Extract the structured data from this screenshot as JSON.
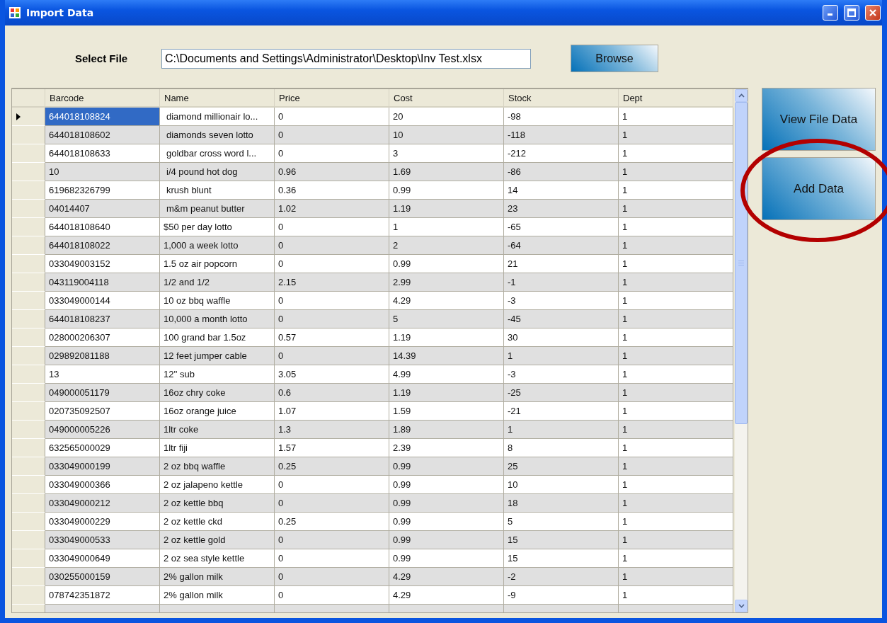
{
  "window": {
    "title": "Import Data"
  },
  "file": {
    "label": "Select File",
    "value": "C:\\Documents and Settings\\Administrator\\Desktop\\Inv Test.xlsx",
    "browse": "Browse"
  },
  "table": {
    "columns": [
      "Barcode",
      "Name",
      "Price",
      "Cost",
      "Stock",
      "Dept"
    ],
    "rows": [
      {
        "selected": true,
        "cells": [
          "644018108824",
          "diamond millionair lo...",
          "0",
          "20",
          "-98",
          "1"
        ]
      },
      {
        "selected": false,
        "cells": [
          "644018108602",
          "diamonds seven lotto",
          "0",
          "10",
          "-118",
          "1"
        ]
      },
      {
        "selected": false,
        "cells": [
          "644018108633",
          "goldbar cross word l...",
          "0",
          "3",
          "-212",
          "1"
        ]
      },
      {
        "selected": false,
        "cells": [
          "10",
          "i/4 pound hot dog",
          "0.96",
          "1.69",
          "-86",
          "1"
        ]
      },
      {
        "selected": false,
        "cells": [
          "619682326799",
          "krush blunt",
          "0.36",
          "0.99",
          "14",
          "1"
        ]
      },
      {
        "selected": false,
        "cells": [
          "04014407",
          "m&m peanut butter",
          "1.02",
          "1.19",
          "23",
          "1"
        ]
      },
      {
        "selected": false,
        "cells": [
          "644018108640",
          "$50 per day lotto",
          "0",
          "1",
          "-65",
          "1"
        ]
      },
      {
        "selected": false,
        "cells": [
          "644018108022",
          "1,000 a week lotto",
          "0",
          "2",
          "-64",
          "1"
        ]
      },
      {
        "selected": false,
        "cells": [
          "033049003152",
          "1.5 oz air popcorn",
          "0",
          "0.99",
          "21",
          "1"
        ]
      },
      {
        "selected": false,
        "cells": [
          "043119004118",
          "1/2 and 1/2",
          "2.15",
          "2.99",
          "-1",
          "1"
        ]
      },
      {
        "selected": false,
        "cells": [
          "033049000144",
          "10 oz bbq waffle",
          "0",
          "4.29",
          "-3",
          "1"
        ]
      },
      {
        "selected": false,
        "cells": [
          "644018108237",
          "10,000 a month lotto",
          "0",
          "5",
          "-45",
          "1"
        ]
      },
      {
        "selected": false,
        "cells": [
          "028000206307",
          "100 grand bar 1.5oz",
          "0.57",
          "1.19",
          "30",
          "1"
        ]
      },
      {
        "selected": false,
        "cells": [
          "029892081188",
          "12 feet jumper cable",
          "0",
          "14.39",
          "1",
          "1"
        ]
      },
      {
        "selected": false,
        "cells": [
          "13",
          "12'' sub",
          "3.05",
          "4.99",
          "-3",
          "1"
        ]
      },
      {
        "selected": false,
        "cells": [
          "049000051179",
          "16oz chry coke",
          "0.6",
          "1.19",
          "-25",
          "1"
        ]
      },
      {
        "selected": false,
        "cells": [
          "020735092507",
          "16oz orange juice",
          "1.07",
          "1.59",
          "-21",
          "1"
        ]
      },
      {
        "selected": false,
        "cells": [
          "049000005226",
          "1ltr coke",
          "1.3",
          "1.89",
          "1",
          "1"
        ]
      },
      {
        "selected": false,
        "cells": [
          "632565000029",
          "1ltr fiji",
          "1.57",
          "2.39",
          "8",
          "1"
        ]
      },
      {
        "selected": false,
        "cells": [
          "033049000199",
          "2 oz bbq waffle",
          "0.25",
          "0.99",
          "25",
          "1"
        ]
      },
      {
        "selected": false,
        "cells": [
          "033049000366",
          "2 oz jalapeno kettle",
          "0",
          "0.99",
          "10",
          "1"
        ]
      },
      {
        "selected": false,
        "cells": [
          "033049000212",
          "2 oz kettle bbq",
          "0",
          "0.99",
          "18",
          "1"
        ]
      },
      {
        "selected": false,
        "cells": [
          "033049000229",
          "2 oz kettle ckd",
          "0.25",
          "0.99",
          "5",
          "1"
        ]
      },
      {
        "selected": false,
        "cells": [
          "033049000533",
          "2 oz kettle gold",
          "0",
          "0.99",
          "15",
          "1"
        ]
      },
      {
        "selected": false,
        "cells": [
          "033049000649",
          "2 oz sea style kettle",
          "0",
          "0.99",
          "15",
          "1"
        ]
      },
      {
        "selected": false,
        "cells": [
          "030255000159",
          "2% gallon milk",
          "0",
          "4.29",
          "-2",
          "1"
        ]
      },
      {
        "selected": false,
        "cells": [
          "078742351872",
          "2% gallon milk",
          "0",
          "4.29",
          "-9",
          "1"
        ]
      }
    ]
  },
  "actions": [
    "View File Data",
    "Add Data"
  ]
}
